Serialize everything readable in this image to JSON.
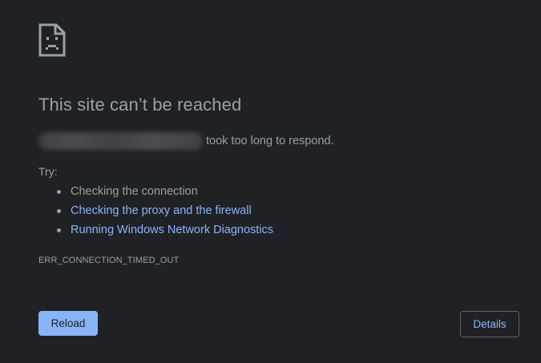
{
  "error_page": {
    "icon": "sad-page-icon",
    "title": "This site can’t be reached",
    "summary_suffix": "took too long to respond.",
    "try_label": "Try:",
    "suggestions": [
      {
        "label": "Checking the connection",
        "is_link": false
      },
      {
        "label": "Checking the proxy and the firewall",
        "is_link": true
      },
      {
        "label": "Running Windows Network Diagnostics",
        "is_link": true
      }
    ],
    "error_code": "ERR_CONNECTION_TIMED_OUT",
    "reload_label": "Reload",
    "details_label": "Details"
  },
  "colors": {
    "background": "#202124",
    "text": "#9aa0a6",
    "link": "#8ab4f8",
    "primary_button": "#8ab4f8"
  }
}
